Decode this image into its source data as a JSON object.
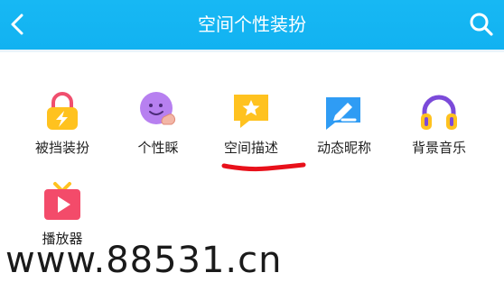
{
  "header": {
    "title": "空间个性装扮",
    "back_icon": "back-chevron-icon",
    "search_icon": "search-icon",
    "bg_color": "#14b4f2"
  },
  "items": [
    {
      "label": "被挡装扮",
      "icon": "lock-bolt-icon"
    },
    {
      "label": "个性睬",
      "icon": "purple-face-thumb-icon"
    },
    {
      "label": "空间描述",
      "icon": "star-speech-bubble-icon"
    },
    {
      "label": "动态昵称",
      "icon": "pen-chat-icon"
    },
    {
      "label": "背景音乐",
      "icon": "headphones-icon"
    },
    {
      "label": "播放器",
      "icon": "tv-play-icon"
    }
  ],
  "annotation_color": "#e8101a",
  "watermark": "www.88531.cn"
}
